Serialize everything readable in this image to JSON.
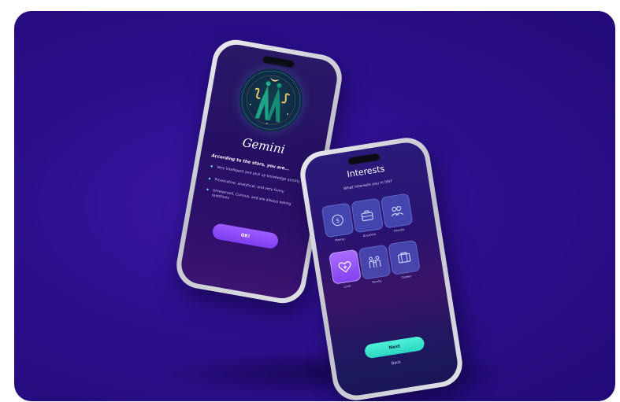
{
  "colors": {
    "background": "#2d0f8e",
    "accent_purple": "#8d4cfa",
    "accent_teal": "#35e2cb"
  },
  "gemini_screen": {
    "zodiac_icon": "gemini-twins-icon",
    "sign_name": "Gemini",
    "traits_intro": "According to the stars, you are...",
    "traits": [
      "Very Intelligent and pick up knowledge quickly",
      "Provocative, analytical, and very funny",
      "Unreserved, Curious, and are always asking questions"
    ],
    "ok_label": "OK!"
  },
  "interests_screen": {
    "title": "Interests",
    "subtitle": "What interests you in life?",
    "tiles": [
      {
        "label": "Money",
        "icon": "money-coin-icon",
        "selected": false
      },
      {
        "label": "Business",
        "icon": "briefcase-icon",
        "selected": false
      },
      {
        "label": "Friends",
        "icon": "friends-icon",
        "selected": false
      },
      {
        "label": "Love",
        "icon": "heart-plus-icon",
        "selected": true
      },
      {
        "label": "Family",
        "icon": "family-icon",
        "selected": false
      },
      {
        "label": "Career",
        "icon": "career-bag-icon",
        "selected": false
      }
    ],
    "next_label": "Next",
    "back_label": "Back"
  }
}
